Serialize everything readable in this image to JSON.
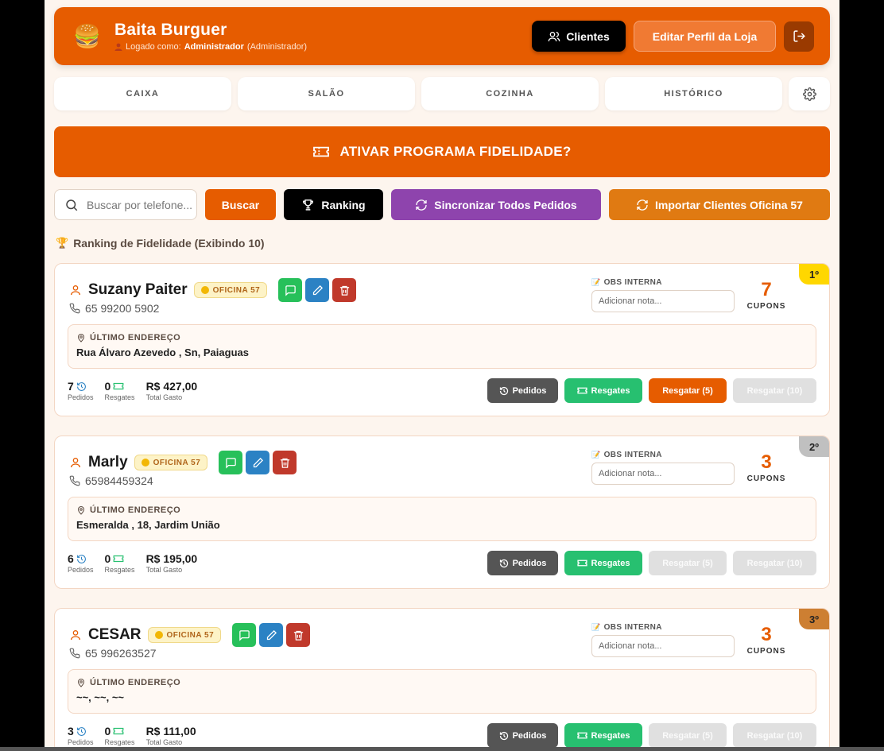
{
  "header": {
    "store_name": "Baita Burguer",
    "logged_prefix": "Logado como:",
    "user_name": "Administrador",
    "user_role": "(Administrador)",
    "clientes_label": "Clientes",
    "editar_label": "Editar Perfil da Loja"
  },
  "nav": {
    "tabs": [
      {
        "label": "CAIXA"
      },
      {
        "label": "SALÃO"
      },
      {
        "label": "COZINHA"
      },
      {
        "label": "HISTÓRICO"
      }
    ]
  },
  "banner": {
    "label": "ATIVAR PROGRAMA FIDELIDADE?"
  },
  "toolbar": {
    "search_placeholder": "Buscar por telefone...",
    "buscar_label": "Buscar",
    "ranking_label": "Ranking",
    "sync_label": "Sincronizar Todos Pedidos",
    "import_label": "Importar Clientes Oficina 57"
  },
  "ranking_title": "Ranking de Fidelidade (Exibindo 10)",
  "labels": {
    "obs": "OBS INTERNA",
    "obs_placeholder": "Adicionar nota...",
    "cupons": "CUPONS",
    "ultimo_endereco": "ÚLTIMO ENDEREÇO",
    "pedidos": "Pedidos",
    "resgates": "Resgates",
    "total_gasto": "Total Gasto",
    "btn_pedidos": "Pedidos",
    "btn_resgates": "Resgates",
    "btn_resgatar5": "Resgatar (5)",
    "btn_resgatar10": "Resgatar (10)"
  },
  "customers": [
    {
      "rank": "1º",
      "name": "Suzany Paiter",
      "tag": "OFICINA 57",
      "phone": "65 99200 5902",
      "cupons": "7",
      "address": "Rua Álvaro Azevedo , Sn, Paiaguas",
      "pedidos": "7",
      "resgates": "0",
      "total": "R$ 427,00",
      "resgatar5_enabled": true
    },
    {
      "rank": "2º",
      "name": "Marly",
      "tag": "OFICINA 57",
      "phone": "65984459324",
      "cupons": "3",
      "address": "Esmeralda , 18, Jardim União",
      "pedidos": "6",
      "resgates": "0",
      "total": "R$ 195,00",
      "resgatar5_enabled": false
    },
    {
      "rank": "3º",
      "name": "CESAR",
      "tag": "OFICINA 57",
      "phone": "65 996263527",
      "cupons": "3",
      "address": "~~, ~~, ~~",
      "pedidos": "3",
      "resgates": "0",
      "total": "R$ 111,00",
      "resgatar5_enabled": false
    }
  ],
  "colors": {
    "accent": "#e65c00",
    "purple": "#8e44ad",
    "green": "#27c070",
    "gold": "#ffd700",
    "silver": "#c0c0c0",
    "bronze": "#cd7f32"
  }
}
